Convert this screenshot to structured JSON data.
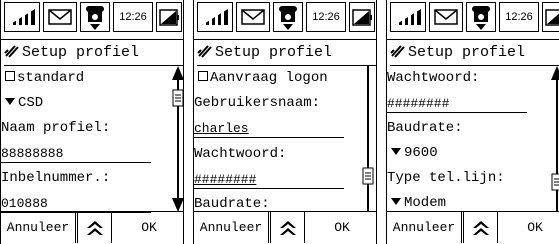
{
  "time": "12:26",
  "title": "Setup profiel",
  "bottom": {
    "left_label": "Annuleer",
    "right_label": "OK"
  },
  "screens": [
    {
      "rows": [
        {
          "type": "check",
          "text": "standard"
        },
        {
          "type": "select",
          "text": "CSD"
        },
        {
          "type": "label",
          "text": "Naam profiel:"
        },
        {
          "type": "field",
          "text": "88888888"
        },
        {
          "type": "label",
          "text": "Inbelnummer.:"
        },
        {
          "type": "field",
          "text": "010888"
        }
      ],
      "scroll_position": 0.1
    },
    {
      "rows": [
        {
          "type": "check",
          "text": "Aanvraag logon"
        },
        {
          "type": "label",
          "text": "Gebruikersnaam:"
        },
        {
          "type": "link",
          "text": "charles"
        },
        {
          "type": "label",
          "text": "Wachtwoord:"
        },
        {
          "type": "link",
          "text": "########"
        },
        {
          "type": "label",
          "text": "Baudrate:"
        }
      ],
      "scroll_position": 0.75
    },
    {
      "rows": [
        {
          "type": "label",
          "text": "Wachtwoord:"
        },
        {
          "type": "field",
          "text": "########"
        },
        {
          "type": "label",
          "text": "Baudrate:"
        },
        {
          "type": "select",
          "text": "9600"
        },
        {
          "type": "label",
          "text": "Type tel.lijn:"
        },
        {
          "type": "select",
          "text": "Modem"
        }
      ],
      "scroll_position": 0.95
    }
  ]
}
